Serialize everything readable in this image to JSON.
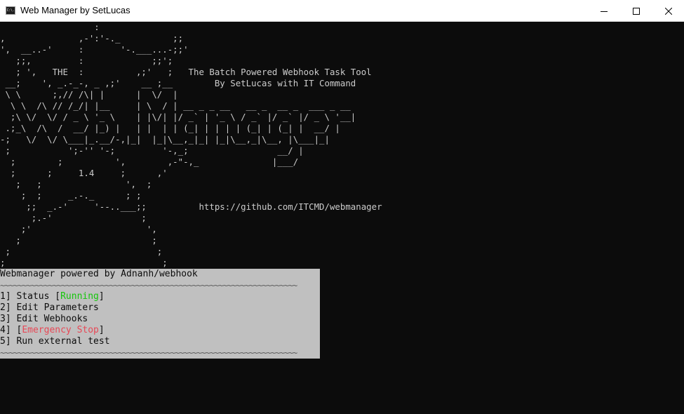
{
  "window": {
    "title": "Web Manager by SetLucas",
    "app_icon": "cmd-icon",
    "app_icon_text": "C:\\.",
    "controls": [
      "minimize-icon",
      "maximize-icon",
      "close-icon"
    ]
  },
  "console": {
    "art_lines": [
      "                  :",
      ",              ,-':'-._          ;;",
      "',  __..-'     :       '-.___...-;;'",
      "   ;;,         :             ;;';",
      "   ; ',   THE  :          ,;'   ;   The Batch Powered Webhook Task Tool",
      " __;    ', _.-_-, _ ,;'    __ ;__        By SetLucas with IT Command",
      " \\ \\      ;,// /\\| |      |  \\/  |",
      "  \\ \\  /\\ // /_/| |__     | \\  / | __ _ _ __   __ _  __ _  ___ _ __",
      "  ;\\ \\/  \\/ / _ \\ '_ \\    | |\\/| |/ _` | '_ \\ / _` |/ _` |/ _ \\ '__|",
      " .;_\\  /\\  /  __/ |_) |   | |  | | (_| | | | | (_| | (_| |  __/ |",
      "-;   \\/  \\/ \\___|_.__/-,|_|  |_|\\__,_|_| |_|\\__,_|\\__, |\\___|_|",
      " ;           ';-'' '-;         '-,_;                 __/ |",
      "  ;        ;          ',        ,-\"-,_              |___/",
      "  ;      ;     1.4     ;      ,'",
      "   ;   ;                ',  ;",
      "    ;  ;     _.-._      ; ;",
      "     ;;  _.-'     '--..___;;          https://github.com/ITCMD/webmanager",
      "      ;.-'                 ;",
      "    ;'                      ',",
      "   ;                         ;",
      " ;                            ;",
      ";                              ;"
    ]
  },
  "menu": {
    "header": "Webmanager powered by Adnanh/webhook",
    "separator": "~~~~~~~~~~~~~~~~~~~~~~~~~~~~~~~~~~~~~~~~~~~~~~~~~~~~~~~~~~~~~~~~~~~~",
    "items": [
      {
        "prefix": "1] Status [",
        "highlight": "Running",
        "suffix": "]"
      },
      {
        "text": "2] Edit Parameters"
      },
      {
        "text": "3] Edit Webhooks"
      },
      {
        "prefix": "4] [",
        "highlight": "Emergency Stop",
        "suffix": "]"
      },
      {
        "text": "5] Run external test"
      }
    ],
    "colors": {
      "panel_bg": "#c0c0c0",
      "running": "#16c60c",
      "emergency": "#e74856"
    }
  }
}
